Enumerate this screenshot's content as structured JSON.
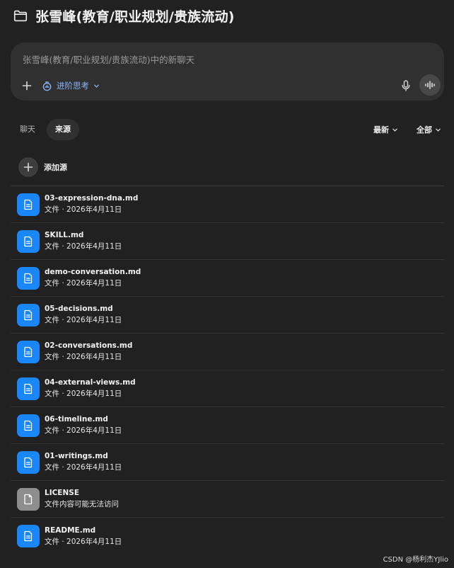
{
  "header": {
    "title": "张雪峰(教育/职业规划/贵族流动)",
    "icon": "folder-icon"
  },
  "composer": {
    "placeholder": "张雪峰(教育/职业规划/贵族流动)中的新聊天",
    "think_label": "进阶思考",
    "icons": [
      "plus-icon",
      "think-icon",
      "chevron-down-icon",
      "mic-icon",
      "voice-wave-icon"
    ]
  },
  "tabs": [
    {
      "label": "聊天",
      "active": false
    },
    {
      "label": "来源",
      "active": true
    }
  ],
  "filters": {
    "sort_label": "最新",
    "scope_label": "全部"
  },
  "add_source": {
    "label": "添加源"
  },
  "files": [
    {
      "name": "03-expression-dna.md",
      "sub": "文件 · 2026年4月11日",
      "icon": "document-icon",
      "color": "#1a86f7"
    },
    {
      "name": "SKILL.md",
      "sub": "文件 · 2026年4月11日",
      "icon": "document-icon",
      "color": "#1a86f7"
    },
    {
      "name": "demo-conversation.md",
      "sub": "文件 · 2026年4月11日",
      "icon": "document-icon",
      "color": "#1a86f7"
    },
    {
      "name": "05-decisions.md",
      "sub": "文件 · 2026年4月11日",
      "icon": "document-icon",
      "color": "#1a86f7"
    },
    {
      "name": "02-conversations.md",
      "sub": "文件 · 2026年4月11日",
      "icon": "document-icon",
      "color": "#1a86f7"
    },
    {
      "name": "04-external-views.md",
      "sub": "文件 · 2026年4月11日",
      "icon": "document-icon",
      "color": "#1a86f7"
    },
    {
      "name": "06-timeline.md",
      "sub": "文件 · 2026年4月11日",
      "icon": "document-icon",
      "color": "#1a86f7"
    },
    {
      "name": "01-writings.md",
      "sub": "文件 · 2026年4月11日",
      "icon": "document-icon",
      "color": "#1a86f7"
    },
    {
      "name": "LICENSE",
      "sub": "文件内容可能无法访问",
      "icon": "blank-file-icon",
      "color": "#8e8e8e"
    },
    {
      "name": "README.md",
      "sub": "文件 · 2026年4月11日",
      "icon": "document-icon",
      "color": "#1a86f7"
    }
  ],
  "watermark": "CSDN @杨利杰YJlio"
}
